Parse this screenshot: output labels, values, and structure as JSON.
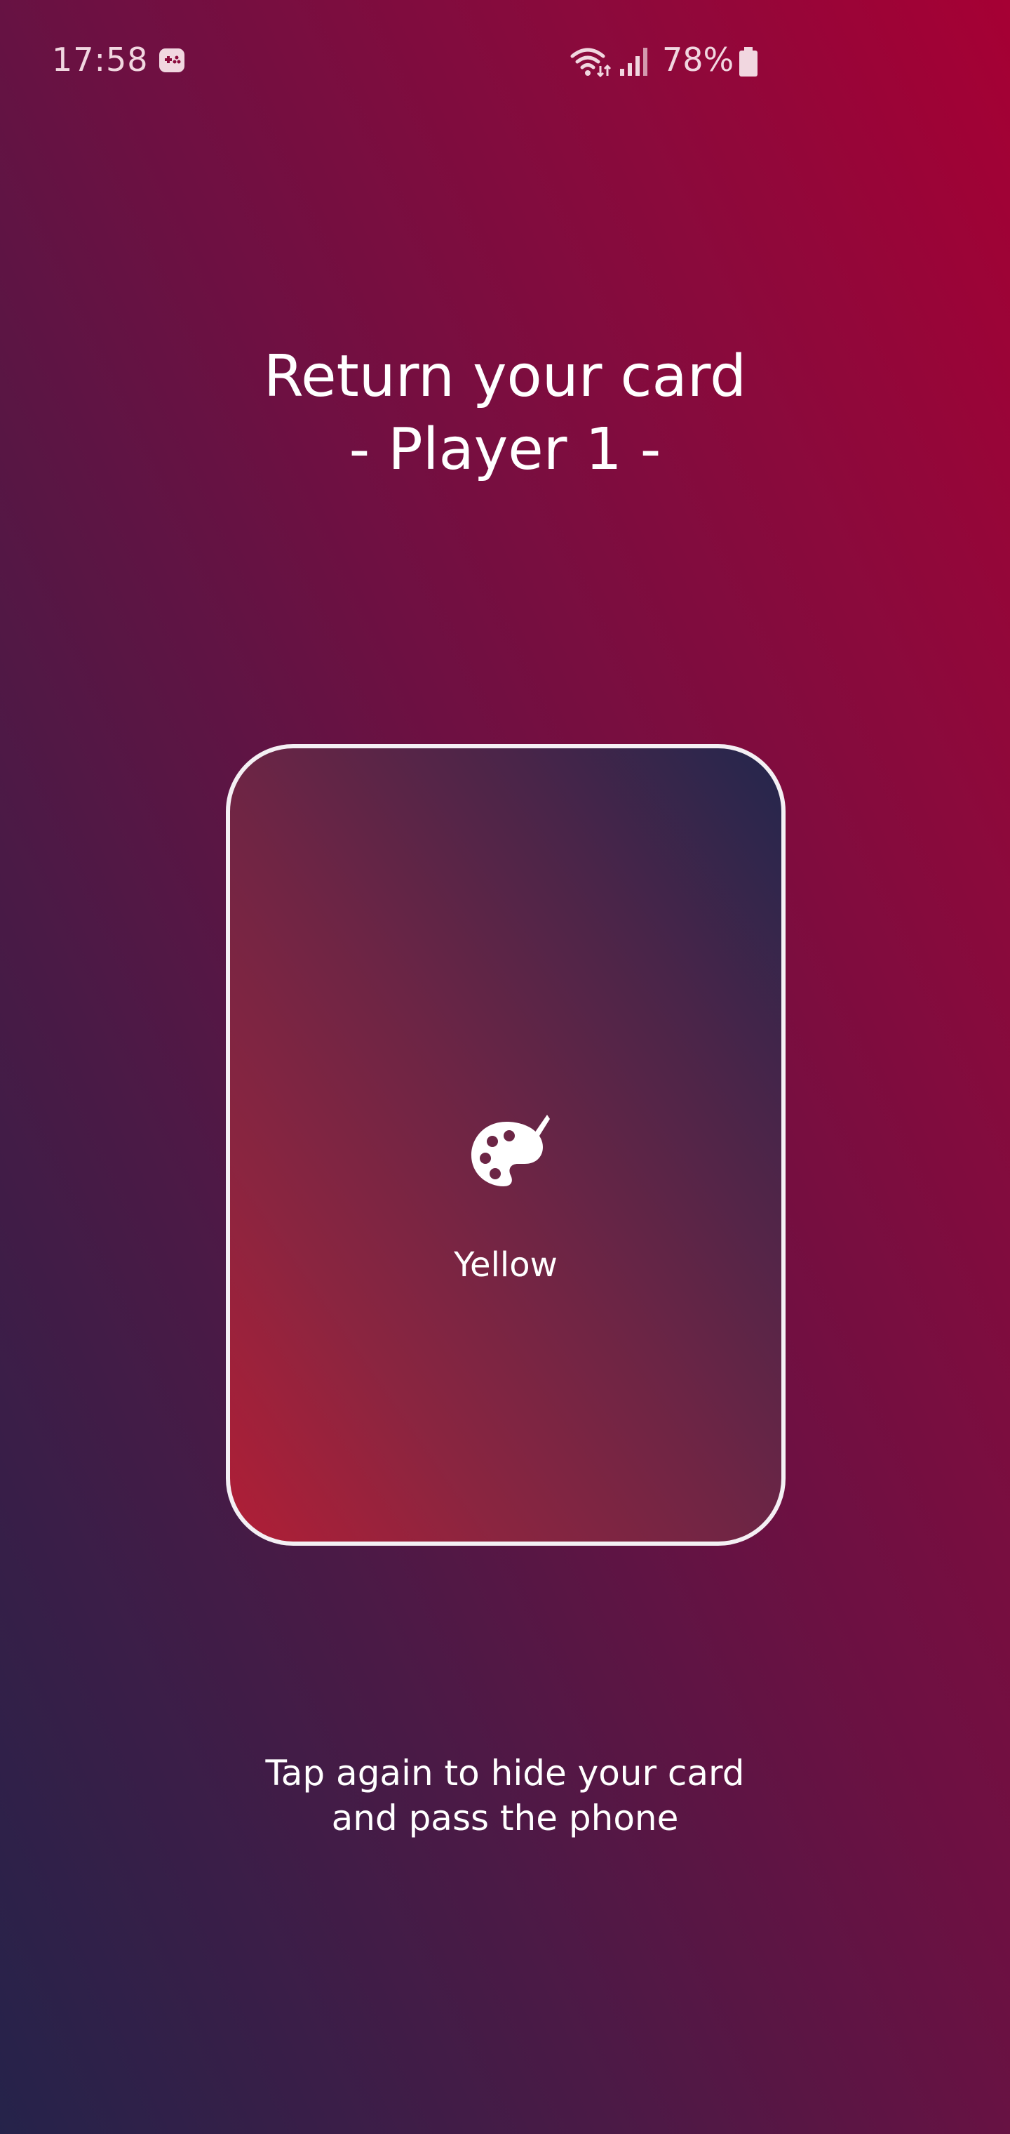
{
  "status_bar": {
    "time": "17:58",
    "battery": "78%",
    "icons": [
      "game-icon",
      "wifi-icon",
      "signal-icon",
      "battery-icon"
    ]
  },
  "title": {
    "line1": "Return your card",
    "line2": "- Player 1 -"
  },
  "card": {
    "icon": "palette-icon",
    "label": "Yellow"
  },
  "instruction": {
    "line1": "Tap again to hide your card",
    "line2": "and pass the phone"
  },
  "colors": {
    "background_top": "#a60034",
    "background_bottom": "#25234a",
    "card_border": "#f4f0f4",
    "text": "#ffffff"
  }
}
